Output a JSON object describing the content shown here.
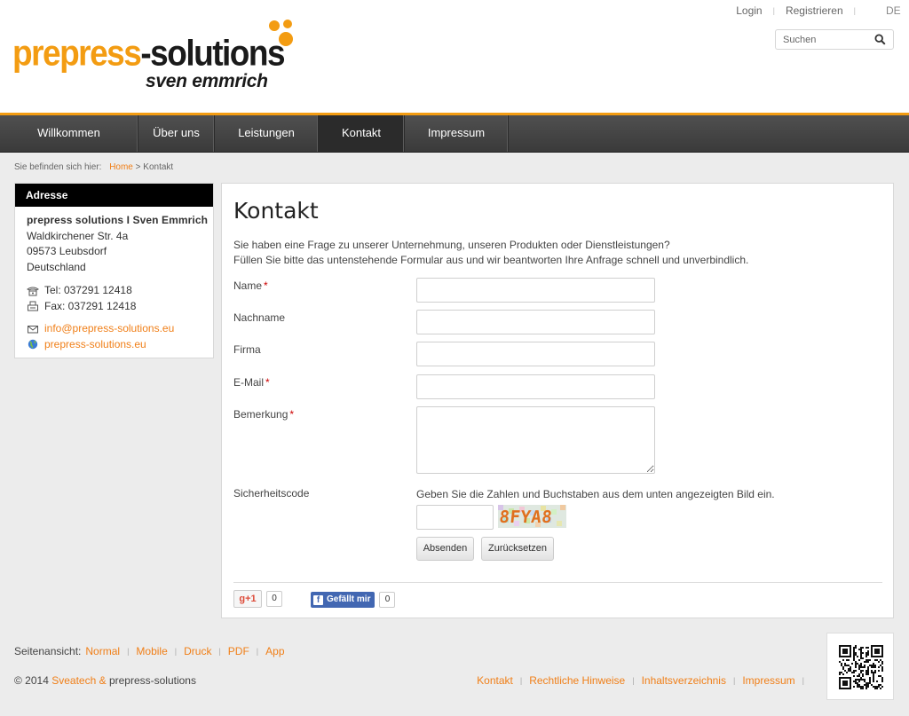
{
  "header": {
    "logo_main_orange": "prepress",
    "logo_main_dark": "-solutions",
    "logo_sub": "sven emmrich",
    "top_links": [
      "Login",
      "Registrieren"
    ],
    "language": "DE",
    "search_placeholder": "Suchen"
  },
  "nav": [
    {
      "label": "Willkommen"
    },
    {
      "label": "Über uns"
    },
    {
      "label": "Leistungen"
    },
    {
      "label": "Kontakt",
      "active": true
    },
    {
      "label": "Impressum"
    }
  ],
  "breadcrumb": {
    "label": "Sie befinden sich hier:",
    "home": "Home",
    "separator": ">",
    "current": "Kontakt"
  },
  "sidebar": {
    "title": "Adresse",
    "company": "prepress solutions I Sven Emmrich",
    "street": "Waldkirchener Str. 4a",
    "city": "09573 Leubsdorf",
    "country": "Deutschland",
    "phone": "Tel:  037291 12418",
    "fax": "Fax: 037291 12418",
    "email": "info@prepress-solutions.eu",
    "web": "prepress-solutions.eu"
  },
  "main": {
    "title": "Kontakt",
    "intro_1": "Sie haben eine Frage zu unserer Unternehmung, unseren Produkten oder Dienstleistungen?",
    "intro_2": "Füllen Sie bitte das untenstehende Formular aus und wir beantworten Ihre Anfrage schnell und unverbindlich.",
    "fields": {
      "name": {
        "label": "Name",
        "required": "*"
      },
      "nachname": {
        "label": "Nachname"
      },
      "firma": {
        "label": "Firma"
      },
      "email": {
        "label": "E-Mail",
        "required": "*"
      },
      "bemerkung": {
        "label": "Bemerkung",
        "required": "*"
      },
      "sicherheitscode": {
        "label": "Sicherheitscode"
      }
    },
    "captcha_hint": "Geben Sie die Zahlen und Buchstaben aus dem unten angezeigten Bild ein.",
    "captcha_text": "8FYA8",
    "submit_label": "Absenden",
    "reset_label": "Zurücksetzen",
    "gplus_label": "+1",
    "gplus_count": "0",
    "fb_label": "Gefällt mir",
    "fb_count": "0"
  },
  "footer": {
    "view_label": "Seitenansicht:",
    "views": [
      "Normal",
      "Mobile",
      "Druck",
      "PDF",
      "App"
    ],
    "copyright_prefix": "© 2014",
    "copyright_link": "Sveatech &",
    "copyright_suffix": "prepress-solutions",
    "links": [
      "Kontakt",
      "Rechtliche Hinweise",
      "Inhaltsverzeichnis",
      "Impressum"
    ]
  },
  "colors": {
    "accent": "#f39c12",
    "link": "#f07f18",
    "nav_bg": "#444444",
    "required": "#cc0000"
  }
}
